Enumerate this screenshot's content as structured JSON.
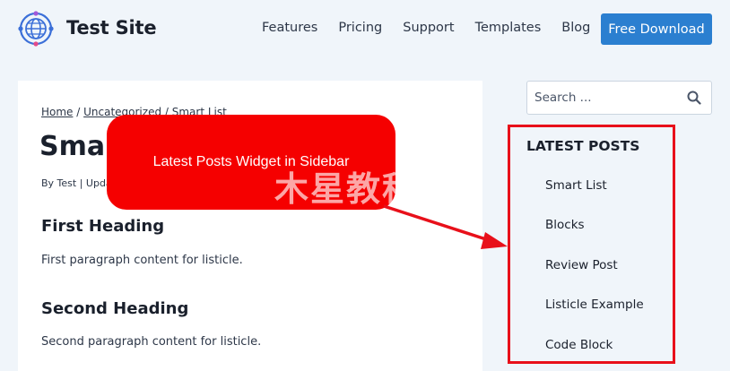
{
  "header": {
    "site_title": "Test Site",
    "nav": [
      "Features",
      "Pricing",
      "Support",
      "Templates",
      "Blog"
    ],
    "download_label": "Free Download"
  },
  "breadcrumb": {
    "home": "Home",
    "sep1": " / ",
    "category": "Uncategorized",
    "sep2": " / ",
    "current": "Smart List"
  },
  "post": {
    "title": "Smart List",
    "meta": "By Test  |  Updated",
    "sections": [
      {
        "heading": "First Heading",
        "paragraph": "First paragraph content for listicle."
      },
      {
        "heading": "Second Heading",
        "paragraph": "Second paragraph content for listicle."
      }
    ]
  },
  "sidebar": {
    "search_placeholder": "Search ...",
    "widget_title": "LATEST POSTS",
    "posts": [
      "Smart List",
      "Blocks",
      "Review Post",
      "Listicle Example",
      "Code Block"
    ]
  },
  "annotation": {
    "text": "Latest Posts Widget in Sidebar",
    "watermark": "木星教程网"
  },
  "colors": {
    "accent": "#2b7fd0",
    "annotation_red": "#f50000",
    "background": "#f0f5fa"
  }
}
